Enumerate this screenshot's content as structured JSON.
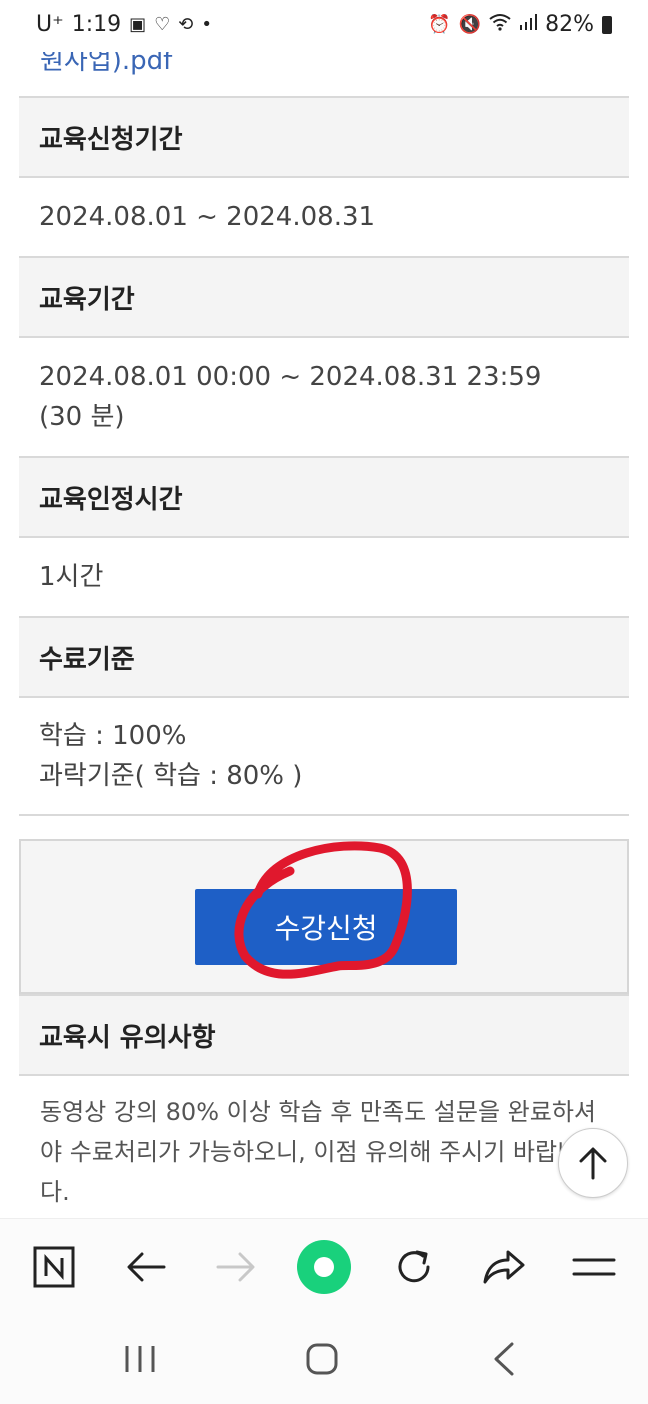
{
  "status_bar": {
    "carrier": "U⁺",
    "time": "1:19",
    "battery": "82%",
    "icons": [
      "gallery-icon",
      "heart-icon",
      "sync-icon",
      "alarm-icon",
      "mute-icon",
      "wifi-icon",
      "signal-icon",
      "battery-icon"
    ]
  },
  "top_link": "원사업).pdf",
  "rows": [
    {
      "label": "교육신청기간",
      "value_lines": [
        "2024.08.01 ~ 2024.08.31"
      ]
    },
    {
      "label": "교육기간",
      "value_lines": [
        "2024.08.01 00:00 ~ 2024.08.31 23:59",
        "(30 분)"
      ]
    },
    {
      "label": "교육인정시간",
      "value_lines": [
        "1시간"
      ]
    },
    {
      "label": "수료기준",
      "value_lines": [
        "학습 : 100%",
        "과락기준( 학습 : 80% )"
      ]
    }
  ],
  "apply_button": "수강신청",
  "notice": {
    "title": "교육시 유의사항",
    "body": "동영상 강의 80% 이상 학습 후 만족도 설문을 완료하셔야 수료처리가 가능하오니, 이점 유의해 주시기 바랍니다."
  },
  "colors": {
    "accent": "#1e5fc6",
    "annotation": "#e0182d",
    "link": "#3a66b5",
    "green_button": "#19d17c"
  },
  "browser_toolbar": [
    "naver-icon",
    "back-arrow-icon",
    "forward-arrow-icon",
    "green-dot-icon",
    "refresh-icon",
    "share-icon",
    "menu-icon"
  ],
  "system_nav": [
    "recent-apps-icon",
    "home-icon",
    "back-icon"
  ]
}
